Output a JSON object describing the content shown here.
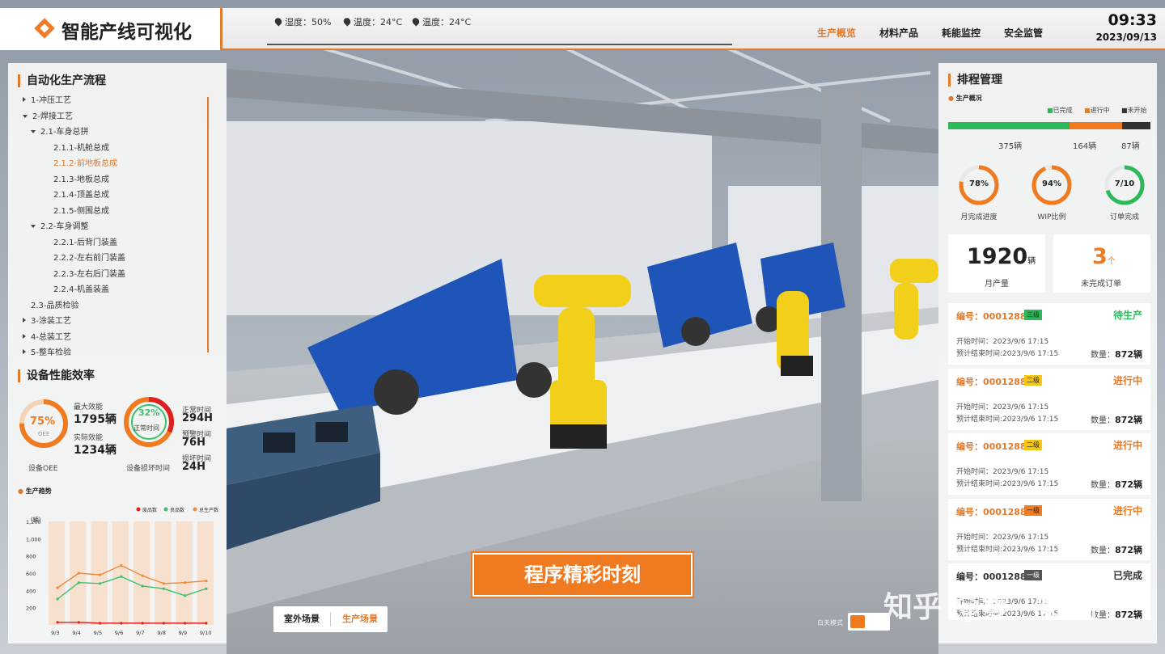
{
  "header": {
    "title": "智能产线可视化",
    "humidity": "湿度：50%",
    "temp1": "温度：24°C",
    "temp2": "温度：24°C",
    "time": "09:33",
    "date": "2023/09/13",
    "nav": [
      "生产概览",
      "材料产品",
      "耗能监控",
      "安全监管"
    ]
  },
  "process": {
    "title": "自动化生产流程",
    "items": [
      {
        "label": "1-冲压工艺",
        "level": 0,
        "expanded": false
      },
      {
        "label": "2-焊接工艺",
        "level": 0,
        "expanded": true
      },
      {
        "label": "2.1-车身总拼",
        "level": 1,
        "expanded": true
      },
      {
        "label": "2.1.1-机舱总成",
        "level": 2
      },
      {
        "label": "2.1.2-前地板总成",
        "level": 2,
        "active": true
      },
      {
        "label": "2.1.3-地板总成",
        "level": 2
      },
      {
        "label": "2.1.4-顶盖总成",
        "level": 2
      },
      {
        "label": "2.1.5-侧围总成",
        "level": 2
      },
      {
        "label": "2.2-车身调整",
        "level": 1,
        "expanded": true
      },
      {
        "label": "2.2.1-后背门装盖",
        "level": 2
      },
      {
        "label": "2.2.2-左右前门装盖",
        "level": 2
      },
      {
        "label": "2.2.3-左右后门装盖",
        "level": 2
      },
      {
        "label": "2.2.4-机盖装盖",
        "level": 2
      },
      {
        "label": "2.3-品质检验",
        "level": 1
      },
      {
        "label": "3-涂装工艺",
        "level": 0,
        "expanded": false
      },
      {
        "label": "4-总装工艺",
        "level": 0,
        "expanded": false
      },
      {
        "label": "5-整车检验",
        "level": 0,
        "expanded": false
      }
    ]
  },
  "equipment": {
    "title": "设备性能效率",
    "oee_value": "75%",
    "oee_center_label": "OEE",
    "oee_label": "设备OEE",
    "max_label": "最大效能",
    "max_value": "1795辆",
    "actual_label": "实际效能",
    "actual_value": "1234辆",
    "loss_value": "32%",
    "loss_center_label": "正常时间",
    "loss_label": "设备损坏时间",
    "normal_label": "正常时间",
    "normal_value": "294H",
    "warn_label": "预警时间",
    "warn_value": "76H",
    "broken_label": "损坏时间",
    "broken_value": "24H",
    "oee_pct": 75,
    "loss_pct": 32
  },
  "trend": {
    "title": "生产趋势",
    "unit": "(辆)",
    "legend": [
      "废品数",
      "良品数",
      "总生产数"
    ],
    "colors": [
      "#e02020",
      "#3cc070",
      "#f08a3a"
    ]
  },
  "chart_data": {
    "type": "line",
    "categories": [
      "9/3",
      "9/4",
      "9/5",
      "9/6",
      "9/7",
      "9/8",
      "9/9",
      "9/10"
    ],
    "ylim": [
      0,
      1200
    ],
    "yticks": [
      200,
      400,
      600,
      800,
      "1,000",
      "1,200"
    ],
    "series": [
      {
        "name": "废品数",
        "values": [
          30,
          30,
          20,
          20,
          20,
          20,
          20,
          20
        ]
      },
      {
        "name": "良品数",
        "values": [
          300,
          490,
          480,
          560,
          450,
          420,
          340,
          420
        ]
      },
      {
        "name": "总生产数",
        "values": [
          430,
          600,
          580,
          690,
          570,
          480,
          490,
          510
        ]
      }
    ]
  },
  "schedule": {
    "title": "排程管理",
    "subtitle": "生产概况",
    "legend": [
      "已完成",
      "进行中",
      "未开始"
    ],
    "colors": [
      "#2db85a",
      "#f07a20",
      "#333333"
    ],
    "done": "375辆",
    "doing": "164辆",
    "todo": "87辆",
    "done_n": 375,
    "doing_n": 164,
    "todo_n": 87,
    "rings": [
      {
        "value": "78%",
        "label": "月完成进度",
        "pct": 78,
        "color": "#f07a20"
      },
      {
        "value": "94%",
        "label": "WIP比例",
        "pct": 94,
        "color": "#f07a20"
      },
      {
        "value": "7/10",
        "label": "订单完成",
        "pct": 70,
        "color": "#2db85a"
      }
    ],
    "monthly_value": "1920",
    "monthly_unit": "辆",
    "monthly_label": "月产量",
    "pending_value": "3",
    "pending_unit": "个",
    "pending_label": "未完成订单"
  },
  "orders": [
    {
      "no": "编号：0001288",
      "level": "三级",
      "status": "待生产",
      "start": "开始时间：2023/9/6  17:15",
      "end": "预计结束时间:2023/9/6  17:15",
      "qty_label": "数量：",
      "qty": "872辆"
    },
    {
      "no": "编号：0001288",
      "level": "二级",
      "status": "进行中",
      "start": "开始时间：2023/9/6  17:15",
      "end": "预计结束时间:2023/9/6  17:15",
      "qty_label": "数量：",
      "qty": "872辆"
    },
    {
      "no": "编号：0001288",
      "level": "二级",
      "status": "进行中",
      "start": "开始时间：2023/9/6  17:15",
      "end": "预计结束时间:2023/9/6  17:15",
      "qty_label": "数量：",
      "qty": "872辆"
    },
    {
      "no": "编号：0001288",
      "level": "一级",
      "status": "进行中",
      "start": "开始时间：2023/9/6  17:15",
      "end": "预计结束时间:2023/9/6  17:15",
      "qty_label": "数量：",
      "qty": "872辆"
    },
    {
      "no": "编号：0001288",
      "level": "一级",
      "status": "已完成",
      "start": "开始时间：2023/9/6  17:15",
      "end": "预计结束时间:2023/9/6  17:15",
      "qty_label": "数量：",
      "qty": "872辆"
    }
  ],
  "banner": "程序精彩时刻",
  "scene_buttons": [
    "室外场景",
    "生产场景"
  ],
  "day_mode": "白天模式",
  "watermark": "知乎 @零一数创"
}
